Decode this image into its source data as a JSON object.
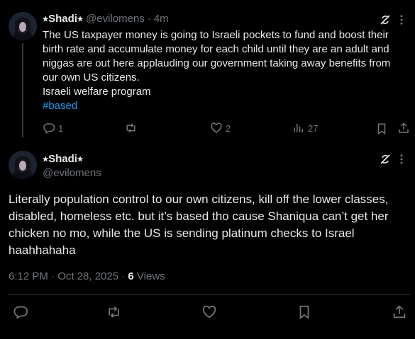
{
  "tweet1": {
    "display_name": "⭑Shadi⭑",
    "handle": "@evilomens",
    "separator": "·",
    "time_ago": "4m",
    "text_lines": [
      "The US taxpayer money is going to Israeli pockets to fund and boost their",
      "birth rate and accumulate money for each child until they are an adult and",
      "niggas are out here applauding our government taking away benefits from",
      "our own US citizens.",
      "Israeli welfare program"
    ],
    "hashtag": "#based",
    "replies": "1",
    "reposts": "",
    "likes": "2",
    "views": "27"
  },
  "tweet2": {
    "display_name": "⭑Shadi⭑",
    "handle": "@evilomens",
    "text_lines": [
      "Literally population control to our own citizens, kill off the lower classes,",
      "disabled, homeless etc. but it’s based tho cause Shaniqua can’t get her",
      "chicken no mo, while the US is sending platinum checks to Israel",
      "haahhahaha"
    ],
    "timestamp": "6:12 PM · Oct 28, 2025 · ",
    "views_count": "6",
    "views_label": " Views"
  },
  "colors": {
    "background": "#000000",
    "text": "#e7e9ea",
    "muted": "#71767b",
    "link": "#1d9bf0",
    "divider": "#2f3336"
  },
  "icons": [
    "avatar-icon",
    "grok-icon",
    "more-icon",
    "reply-icon",
    "repost-icon",
    "like-icon",
    "views-icon",
    "bookmark-icon",
    "share-icon"
  ]
}
